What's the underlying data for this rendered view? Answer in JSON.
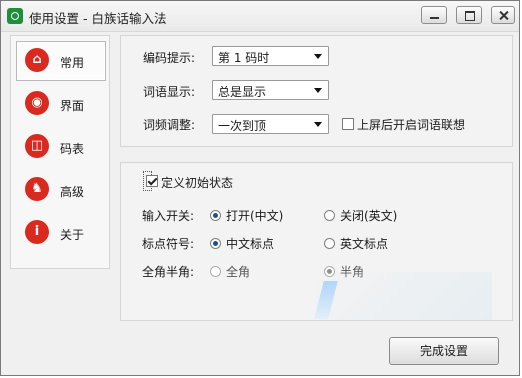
{
  "window": {
    "title": "使用设置 - 白族话输入法"
  },
  "sidebar": {
    "items": [
      {
        "label": "常用",
        "icon": "home-icon"
      },
      {
        "label": "界面",
        "icon": "location-icon"
      },
      {
        "label": "码表",
        "icon": "keyboard-icon"
      },
      {
        "label": "高级",
        "icon": "lion-icon"
      },
      {
        "label": "关于",
        "icon": "info-icon"
      }
    ]
  },
  "settings_top": {
    "encoding_hint_label": "编码提示:",
    "encoding_hint_value": "第 1 码时",
    "phrase_display_label": "词语显示:",
    "phrase_display_value": "总是显示",
    "frequency_adjust_label": "词频调整:",
    "frequency_adjust_value": "一次到顶",
    "association_label": "上屏后开启词语联想"
  },
  "initial_state": {
    "group_label": "定义初始状态",
    "input_switch_label": "输入开关:",
    "input_on_label": "打开(中文)",
    "input_off_label": "关闭(英文)",
    "punctuation_label": "标点符号:",
    "punctuation_cn_label": "中文标点",
    "punctuation_en_label": "英文标点",
    "width_label": "全角半角:",
    "full_width_label": "全角",
    "half_width_label": "半角"
  },
  "buttons": {
    "finish_label": "完成设置"
  }
}
